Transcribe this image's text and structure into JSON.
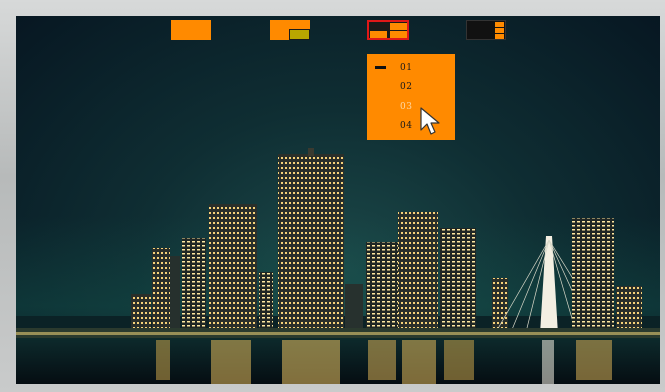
{
  "layout_selector": {
    "tiles": [
      {
        "name": "layout-single",
        "icon": "single-pane-icon"
      },
      {
        "name": "layout-split-inset",
        "icon": "inset-pane-icon"
      },
      {
        "name": "layout-quad",
        "icon": "quad-pane-icon",
        "selected": true,
        "selected_color": "#e01818"
      },
      {
        "name": "layout-side-stack",
        "icon": "side-stack-icon"
      }
    ],
    "accent_color": "#ff8a00"
  },
  "dropdown": {
    "options": [
      {
        "label": "01",
        "selected": true
      },
      {
        "label": "02"
      },
      {
        "label": "03",
        "hovered": true
      },
      {
        "label": "04"
      }
    ]
  },
  "cursor": {
    "icon": "mouse-pointer-icon"
  }
}
